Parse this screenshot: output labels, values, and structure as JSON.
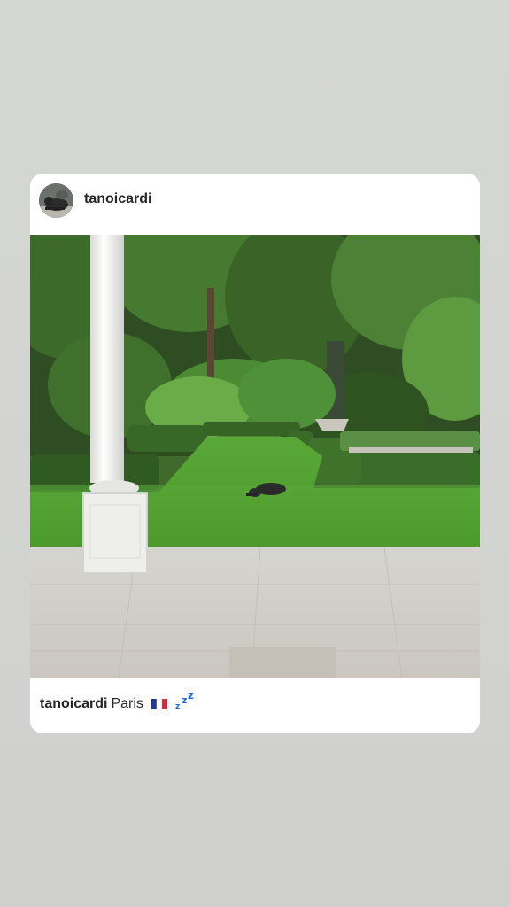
{
  "story": {
    "post": {
      "username": "tanoicardi",
      "avatar_icon": "dog-avatar-icon",
      "image_description_icon": "garden-photo",
      "caption": {
        "username": "tanoicardi",
        "text": "Paris",
        "emojis": [
          "france-flag-icon",
          "zzz-sleeping-icon"
        ]
      }
    },
    "colors": {
      "background": "#d4d5d2",
      "card": "#ffffff",
      "text": "#262626",
      "zzz": "#1f6fd6"
    }
  }
}
